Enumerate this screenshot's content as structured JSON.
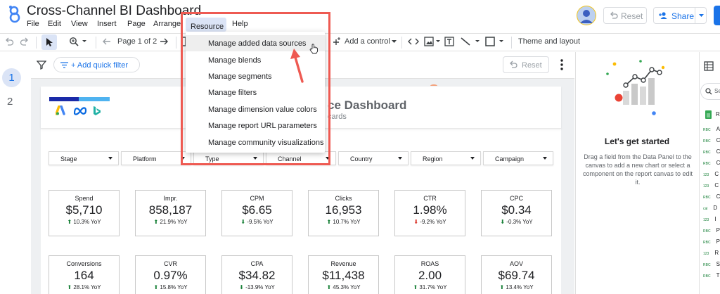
{
  "app": {
    "title": "Cross-Channel BI Dashboard"
  },
  "menubar": {
    "items": [
      "File",
      "Edit",
      "View",
      "Insert",
      "Page",
      "Arrange",
      "Resource",
      "Help"
    ]
  },
  "header": {
    "reset_label": "Reset",
    "share_label": "Share"
  },
  "toolbar": {
    "page_indicator": "Page 1 of 2",
    "add_control_label": "Add a control",
    "theme_label": "Theme and layout"
  },
  "pages_panel": {
    "pages": [
      "1",
      "2"
    ]
  },
  "canvas": {
    "quick_filter_label": "+ Add quick filter",
    "reset_label": "Reset"
  },
  "report": {
    "title_fragment": "ce Dashboard",
    "subtitle_fragment": "cards",
    "brand_colors": [
      "#1a2aa8",
      "#4fb3f0"
    ],
    "filters": [
      "Stage",
      "Platform",
      "Type",
      "Channel",
      "Country",
      "Region",
      "Campaign"
    ],
    "kpis_row1": [
      {
        "label": "Spend",
        "value": "$5,710",
        "delta": "10.3% YoY",
        "trend": "up-good"
      },
      {
        "label": "Impr.",
        "value": "858,187",
        "delta": "21.9% YoY",
        "trend": "up-good"
      },
      {
        "label": "CPM",
        "value": "$6.65",
        "delta": "-9.5% YoY",
        "trend": "down-good"
      },
      {
        "label": "Clicks",
        "value": "16,953",
        "delta": "10.7% YoY",
        "trend": "up-good"
      },
      {
        "label": "CTR",
        "value": "1.98%",
        "delta": "-9.2% YoY",
        "trend": "down-bad"
      },
      {
        "label": "CPC",
        "value": "$0.34",
        "delta": "-0.3% YoY",
        "trend": "down-good"
      }
    ],
    "kpis_row2": [
      {
        "label": "Conversions",
        "value": "164",
        "delta": "28.1% YoY",
        "trend": "up-good"
      },
      {
        "label": "CVR",
        "value": "0.97%",
        "delta": "15.8% YoY",
        "trend": "up-good"
      },
      {
        "label": "CPA",
        "value": "$34.82",
        "delta": "-13.9% YoY",
        "trend": "down-good"
      },
      {
        "label": "Revenue",
        "value": "$11,438",
        "delta": "45.3% YoY",
        "trend": "up-good"
      },
      {
        "label": "ROAS",
        "value": "2.00",
        "delta": "31.7% YoY",
        "trend": "up-good"
      },
      {
        "label": "AOV",
        "value": "$69.74",
        "delta": "13.4% YoY",
        "trend": "up-good"
      }
    ]
  },
  "resource_menu": {
    "items": [
      "Manage added data sources",
      "Manage blends",
      "Manage segments",
      "Manage filters",
      "Manage dimension value colors",
      "Manage report URL parameters",
      "Manage community visualizations"
    ]
  },
  "get_started": {
    "title": "Let's get started",
    "body": "Drag a field from the Data Panel to the canvas to add a new chart or select a component on the report canvas to edit it."
  },
  "data_panel": {
    "search_fragment": "Se",
    "source_fragment": "R",
    "fields": [
      {
        "type": "RBC",
        "name": "A"
      },
      {
        "type": "RBC",
        "name": "C"
      },
      {
        "type": "RBC",
        "name": "C"
      },
      {
        "type": "RBC",
        "name": "C"
      },
      {
        "type": "123",
        "name": "C"
      },
      {
        "type": "123",
        "name": "C"
      },
      {
        "type": "RBC",
        "name": "C"
      },
      {
        "type": "cal",
        "name": "D"
      },
      {
        "type": "123",
        "name": "I"
      },
      {
        "type": "RBC",
        "name": "P"
      },
      {
        "type": "RBC",
        "name": "P"
      },
      {
        "type": "123",
        "name": "R"
      },
      {
        "type": "RBC",
        "name": "S"
      },
      {
        "type": "RBC",
        "name": "T"
      }
    ]
  },
  "colors": {
    "accent": "#1a73e8",
    "highlight_box": "#ee5a52",
    "positive": "#188038",
    "negative": "#d93025"
  }
}
